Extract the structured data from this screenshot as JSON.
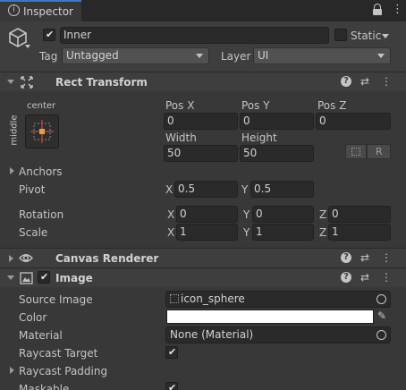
{
  "tab": {
    "label": "Inspector"
  },
  "object": {
    "active": true,
    "name": "Inner",
    "static_label": "Static",
    "static_checked": false,
    "tag_label": "Tag",
    "tag_value": "Untagged",
    "layer_label": "Layer",
    "layer_value": "UI"
  },
  "rect_transform": {
    "title": "Rect Transform",
    "anchor_preset_h": "center",
    "anchor_preset_v": "middle",
    "pos_x_label": "Pos X",
    "pos_x": "0",
    "pos_y_label": "Pos Y",
    "pos_y": "0",
    "pos_z_label": "Pos Z",
    "pos_z": "0",
    "width_label": "Width",
    "width": "50",
    "height_label": "Height",
    "height": "50",
    "r_button": "R",
    "anchors_label": "Anchors",
    "pivot_label": "Pivot",
    "pivot_x": "0.5",
    "pivot_y": "0.5",
    "rotation_label": "Rotation",
    "rot_x": "0",
    "rot_y": "0",
    "rot_z": "0",
    "scale_label": "Scale",
    "scale_x": "1",
    "scale_y": "1",
    "scale_z": "1",
    "axis_x": "X",
    "axis_y": "Y",
    "axis_z": "Z"
  },
  "canvas_renderer": {
    "title": "Canvas Renderer"
  },
  "image": {
    "title": "Image",
    "enabled": true,
    "source_image_label": "Source Image",
    "source_image_value": "icon_sphere",
    "color_label": "Color",
    "color_value": "#ffffff",
    "material_label": "Material",
    "material_value": "None (Material)",
    "raycast_target_label": "Raycast Target",
    "raycast_target": true,
    "raycast_padding_label": "Raycast Padding",
    "maskable_label": "Maskable",
    "maskable": true
  }
}
